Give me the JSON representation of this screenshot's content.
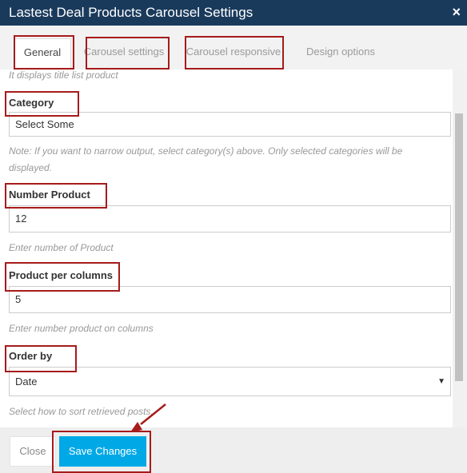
{
  "window": {
    "title": "Lastest Deal Products Carousel Settings",
    "close_glyph": "×"
  },
  "tabs": [
    {
      "label": "General",
      "active": true
    },
    {
      "label": "Carousel settings",
      "active": false
    },
    {
      "label": "Carousel responsive",
      "active": false
    },
    {
      "label": "Design options",
      "active": false
    }
  ],
  "form": {
    "intro_hint": "It displays title list product",
    "category": {
      "label": "Category",
      "value": "Select Some",
      "hint": "Note: If you want to narrow output, select category(s) above. Only selected categories will be displayed."
    },
    "number_product": {
      "label": "Number Product",
      "value": "12",
      "hint": "Enter number of Product"
    },
    "product_per_columns": {
      "label": "Product per columns",
      "value": "5",
      "hint": "Enter number product on columns"
    },
    "order_by": {
      "label": "Order by",
      "value": "Date",
      "hint": "Select how to sort retrieved posts."
    }
  },
  "footer": {
    "close_label": "Close",
    "save_label": "Save Changes"
  },
  "colors": {
    "title_bar": "#1a3a5c",
    "save_button": "#00a8e6",
    "highlight": "#a61b1b"
  }
}
